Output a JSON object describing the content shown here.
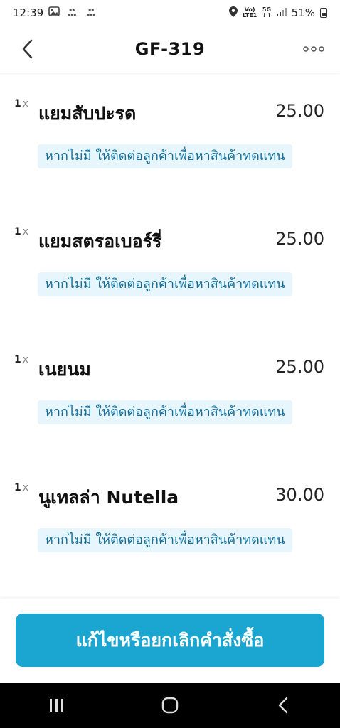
{
  "status_bar": {
    "time": "12:39",
    "network": "LTE1",
    "signal_mode": "5G",
    "battery": "51%"
  },
  "header": {
    "title": "GF-319"
  },
  "items": [
    {
      "qty": "1",
      "x": "x",
      "name": "แยมสับปะรด",
      "price": "25.00",
      "note": "หากไม่มี ให้ติดต่อลูกค้าเพื่อหาสินค้าทดแทน"
    },
    {
      "qty": "1",
      "x": "x",
      "name": "แยมสตรอเบอร์รี่",
      "price": "25.00",
      "note": "หากไม่มี ให้ติดต่อลูกค้าเพื่อหาสินค้าทดแทน"
    },
    {
      "qty": "1",
      "x": "x",
      "name": "เนยนม",
      "price": "25.00",
      "note": "หากไม่มี ให้ติดต่อลูกค้าเพื่อหาสินค้าทดแทน"
    },
    {
      "qty": "1",
      "x": "x",
      "name": "นูเทลล่า Nutella",
      "price": "30.00",
      "note": "หากไม่มี ให้ติดต่อลูกค้าเพื่อหาสินค้าทดแทน"
    }
  ],
  "action": {
    "edit_cancel_label": "แก้ไขหรือยกเลิกคำสั่งซื้อ"
  },
  "colors": {
    "accent": "#1aa6d1",
    "note_bg": "#e6f6fc",
    "note_text": "#156d98"
  }
}
